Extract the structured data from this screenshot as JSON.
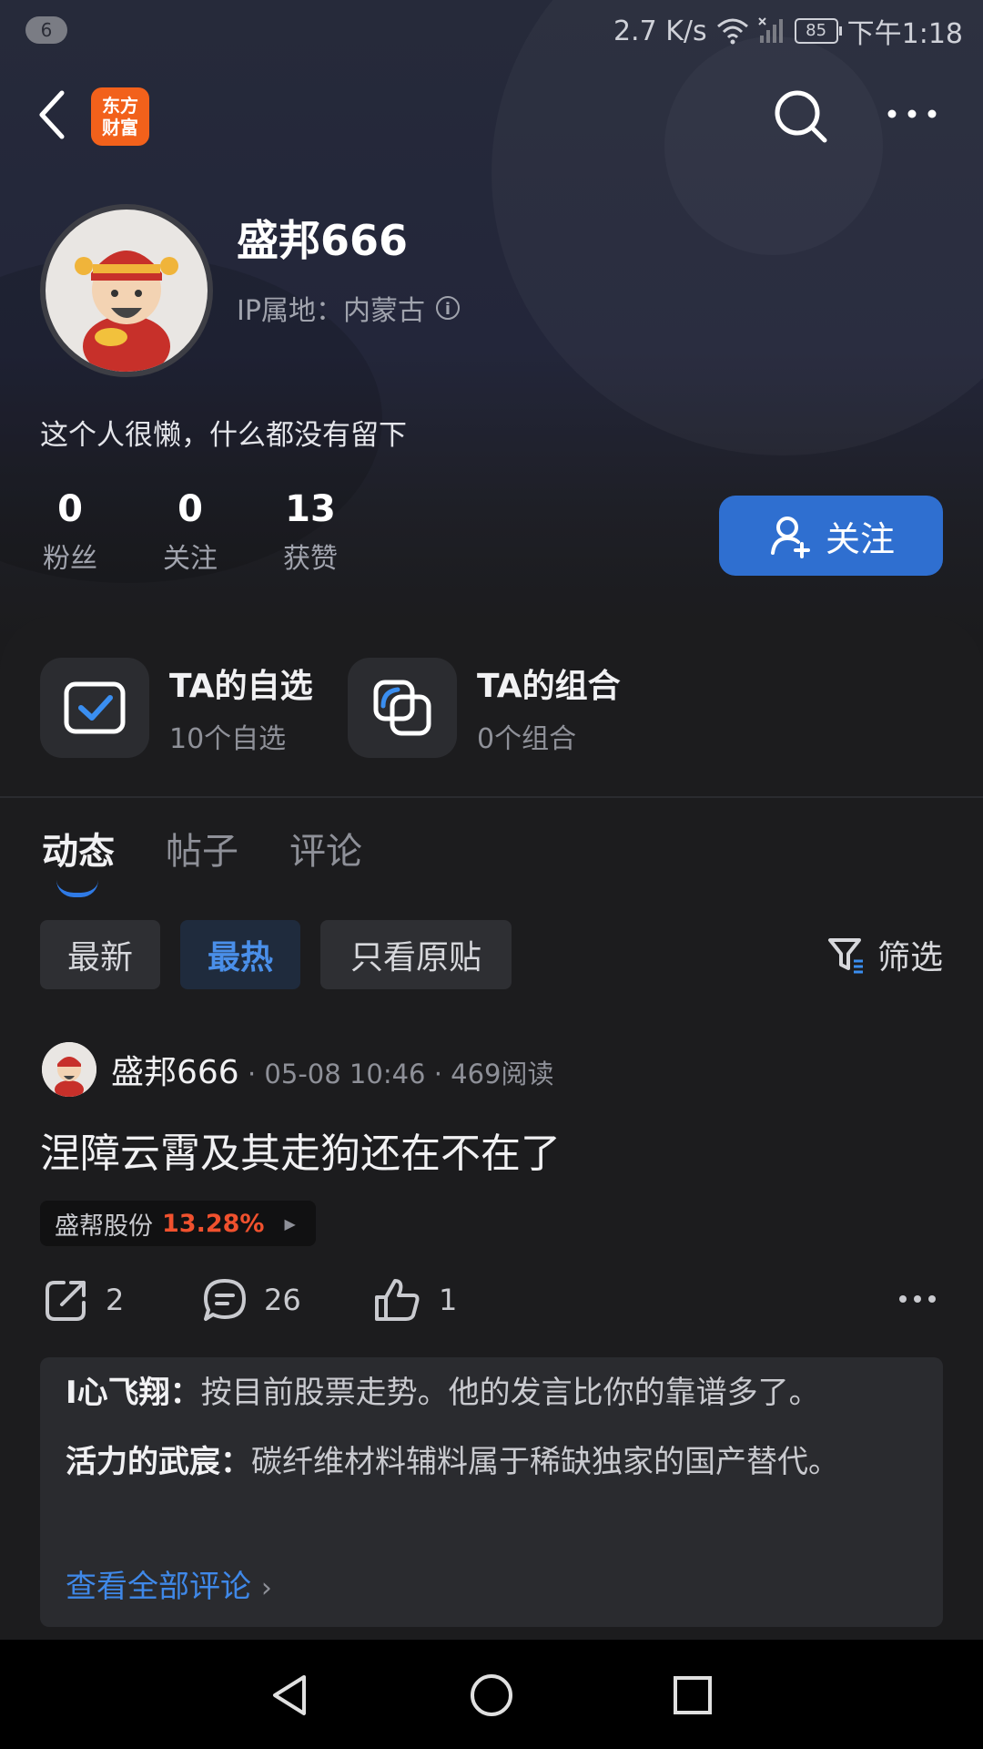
{
  "status_bar": {
    "notification_count": "6",
    "speed": "2.7 K/s",
    "battery": "85",
    "time": "下午1:18"
  },
  "nav": {
    "logo_line1": "东方",
    "logo_line2": "财富"
  },
  "profile": {
    "username": "盛邦666",
    "ip_label": "IP属地：内蒙古",
    "info_glyph": "i",
    "bio": "这个人很懒，什么都没有留下",
    "stats": [
      {
        "value": "0",
        "label": "粉丝"
      },
      {
        "value": "0",
        "label": "关注"
      },
      {
        "value": "13",
        "label": "获赞"
      }
    ],
    "follow_label": "关注"
  },
  "quick_links": [
    {
      "title": "TA的自选",
      "subtitle": "10个自选",
      "icon": "checkbox-icon"
    },
    {
      "title": "TA的组合",
      "subtitle": "0个组合",
      "icon": "overlap-squares-icon"
    }
  ],
  "tabs": [
    "动态",
    "帖子",
    "评论"
  ],
  "active_tab": "动态",
  "sort_chips": [
    "最新",
    "最热",
    "只看原贴"
  ],
  "active_chip": "最热",
  "filter_label": "筛选",
  "post": {
    "author": "盛邦666",
    "meta": "· 05-08 10:46 · 469阅读",
    "title": "涅障云霄及其走狗还在不在了",
    "stock_name": "盛帮股份",
    "stock_change": "13.28%",
    "shares": "2",
    "comments": "26",
    "likes": "1",
    "comment_preview": [
      {
        "name": "I心飞翔：",
        "text": "按目前股票走势。他的发言比你的靠谱多了。"
      },
      {
        "name": "活力的武宸：",
        "text": "碳纤维材料辅料属于稀缺独家的国产替代。"
      }
    ],
    "view_all": "查看全部评论"
  },
  "colors": {
    "accent_blue": "#2f6fd0",
    "stock_red": "#f0512e",
    "logo_orange": "#f2611b"
  }
}
